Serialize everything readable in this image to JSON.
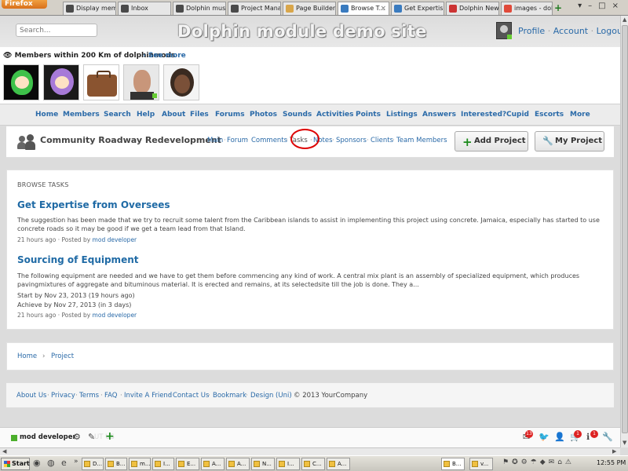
{
  "browser": {
    "app_button": "Firefox",
    "tabs": [
      {
        "label": "Display mem...",
        "icon": "dolphin-icon"
      },
      {
        "label": "Inbox",
        "icon": "dolphin-icon"
      },
      {
        "label": "Dolphin must ...",
        "icon": "dolphin-icon"
      },
      {
        "label": "Project Mana...",
        "icon": "dolphin-icon"
      },
      {
        "label": "Page Builder",
        "icon": "page-icon"
      },
      {
        "label": "Browse T...",
        "icon": "page-icon",
        "active": true
      },
      {
        "label": "Get Expertis...",
        "icon": "page-icon"
      },
      {
        "label": "Dolphin News...",
        "icon": "globe-icon"
      },
      {
        "label": "images - dolp...",
        "icon": "google-icon"
      }
    ],
    "close_glyph": "×",
    "new_tab_glyph": "+"
  },
  "header": {
    "search_placeholder": "Search...",
    "site_title": "Dolphin module demo site",
    "links": [
      "Profile",
      "Account",
      "Logout"
    ]
  },
  "members": {
    "heading": "Members within 200 Km of dolphinmods",
    "see_more": "See more",
    "thumbs": [
      "member-avatar-1",
      "member-avatar-2",
      "member-avatar-3",
      "member-avatar-4",
      "member-avatar-5"
    ]
  },
  "nav": [
    "Home",
    "Members",
    "Search",
    "Help",
    "About",
    "Files",
    "Forums",
    "Photos",
    "Sounds",
    "Activities",
    "Points",
    "Listings",
    "Answers",
    "Interested?",
    "Cupid",
    "Escorts",
    "More"
  ],
  "project": {
    "title": "Community Roadway Redevelopment",
    "subnav": [
      "Main",
      "Forum",
      "Comments",
      "Tasks",
      "Notes",
      "Sponsors",
      "Clients",
      "Team Members"
    ],
    "add_button": "Add Project",
    "my_button": "My Project"
  },
  "browse": {
    "label": "BROWSE TASKS",
    "tasks": [
      {
        "title": "Get Expertise from Oversees",
        "desc": "The suggestion has been made that we try to recruit some talent from the Caribbean islands to assist in implementing this project using concrete. Jamaica, especially has started to use concrete roads so it may be good if we get a team lead from that Island.",
        "meta_time": "21 hours ago",
        "meta_posted": "· Posted by",
        "meta_author": "mod developer"
      },
      {
        "title": "Sourcing of Equipment",
        "desc": "The following equipment are needed and we have to get them before commencing any kind of work. A central mix plant is an assembly of specialized equipment, which produces pavingmixtures of aggregate and bituminous material. It is erected and remains, at its selectedsite till the job is done. They a...",
        "start": "Start by Nov 23, 2013 (19 hours ago)",
        "achieve": "Achieve by Nov 27, 2013 (in 3 days)",
        "meta_time": "21 hours ago",
        "meta_posted": "· Posted by",
        "meta_author": "mod developer"
      }
    ]
  },
  "breadcrumb": [
    "Home",
    "Project"
  ],
  "breadcrumb_sep": "›",
  "footer": {
    "links": [
      "About Us",
      "Privacy",
      "Terms",
      "FAQ",
      "Invite A Friend",
      "Contact Us",
      "Bookmark",
      "Design (Uni)"
    ],
    "copyright": "© 2013 YourCompany"
  },
  "toolbar": {
    "username": "mod developer",
    "ghost_text": "UT US",
    "badge_mail": "13",
    "badge_cart": "1",
    "badge_notify": "1"
  },
  "taskbar": {
    "start": "Start",
    "apps": [
      "D...",
      "B...",
      "m...",
      "I...",
      "E...",
      "A...",
      "A...",
      "N...",
      "I...",
      "C...",
      "A...",
      "B...",
      "v..."
    ],
    "time": "12:55 PM"
  },
  "colors": {
    "link": "#2a6aa8",
    "title_blue": "#1f6aa5",
    "annotation_red": "#dd0000",
    "add_green": "#1b8a1b"
  }
}
